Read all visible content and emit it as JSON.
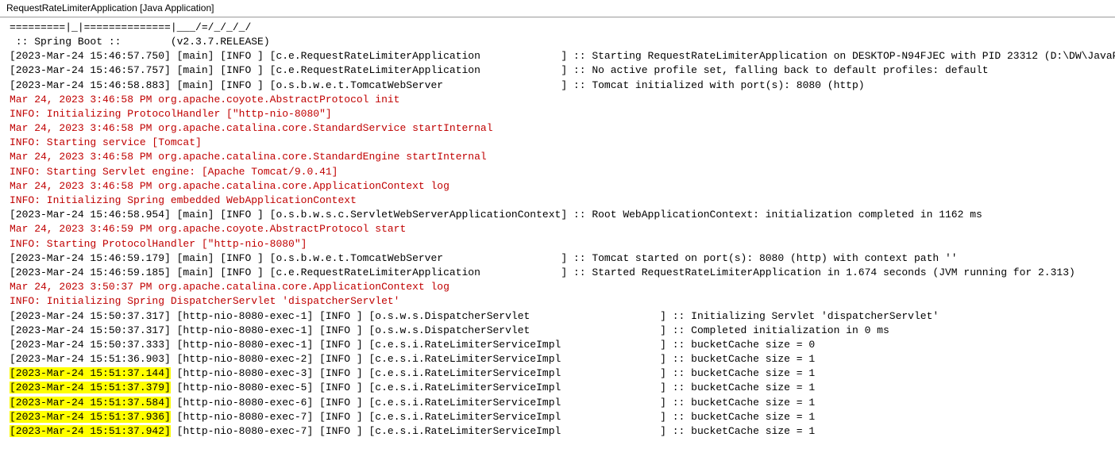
{
  "title": "RequestRateLimiterApplication [Java Application]",
  "lines": [
    {
      "text": "=========|_|==============|___/=/_/_/_/",
      "color": "black"
    },
    {
      "text": " :: Spring Boot ::        (v2.3.7.RELEASE)",
      "color": "black"
    },
    {
      "text": "",
      "color": "black"
    },
    {
      "text": "[2023-Mar-24 15:46:57.750] [main] [INFO ] [c.e.RequestRateLimiterApplication             ] :: Starting RequestRateLimiterApplication on DESKTOP-N94FJEC with PID 23312 (D:\\DW\\JavaP",
      "color": "black"
    },
    {
      "text": "[2023-Mar-24 15:46:57.757] [main] [INFO ] [c.e.RequestRateLimiterApplication             ] :: No active profile set, falling back to default profiles: default",
      "color": "black"
    },
    {
      "text": "[2023-Mar-24 15:46:58.883] [main] [INFO ] [o.s.b.w.e.t.TomcatWebServer                   ] :: Tomcat initialized with port(s): 8080 (http)",
      "color": "black"
    },
    {
      "text": "Mar 24, 2023 3:46:58 PM org.apache.coyote.AbstractProtocol init",
      "color": "red"
    },
    {
      "text": "INFO: Initializing ProtocolHandler [\"http-nio-8080\"]",
      "color": "red"
    },
    {
      "text": "Mar 24, 2023 3:46:58 PM org.apache.catalina.core.StandardService startInternal",
      "color": "red"
    },
    {
      "text": "INFO: Starting service [Tomcat]",
      "color": "red"
    },
    {
      "text": "Mar 24, 2023 3:46:58 PM org.apache.catalina.core.StandardEngine startInternal",
      "color": "red"
    },
    {
      "text": "INFO: Starting Servlet engine: [Apache Tomcat/9.0.41]",
      "color": "red"
    },
    {
      "text": "Mar 24, 2023 3:46:58 PM org.apache.catalina.core.ApplicationContext log",
      "color": "red"
    },
    {
      "text": "INFO: Initializing Spring embedded WebApplicationContext",
      "color": "red"
    },
    {
      "text": "[2023-Mar-24 15:46:58.954] [main] [INFO ] [o.s.b.w.s.c.ServletWebServerApplicationContext] :: Root WebApplicationContext: initialization completed in 1162 ms",
      "color": "black"
    },
    {
      "text": "Mar 24, 2023 3:46:59 PM org.apache.coyote.AbstractProtocol start",
      "color": "red"
    },
    {
      "text": "INFO: Starting ProtocolHandler [\"http-nio-8080\"]",
      "color": "red"
    },
    {
      "text": "[2023-Mar-24 15:46:59.179] [main] [INFO ] [o.s.b.w.e.t.TomcatWebServer                   ] :: Tomcat started on port(s): 8080 (http) with context path ''",
      "color": "black"
    },
    {
      "text": "[2023-Mar-24 15:46:59.185] [main] [INFO ] [c.e.RequestRateLimiterApplication             ] :: Started RequestRateLimiterApplication in 1.674 seconds (JVM running for 2.313)",
      "color": "black"
    },
    {
      "text": "Mar 24, 2023 3:50:37 PM org.apache.catalina.core.ApplicationContext log",
      "color": "red"
    },
    {
      "text": "INFO: Initializing Spring DispatcherServlet 'dispatcherServlet'",
      "color": "red"
    },
    {
      "text": "[2023-Mar-24 15:50:37.317] [http-nio-8080-exec-1] [INFO ] [o.s.w.s.DispatcherServlet                     ] :: Initializing Servlet 'dispatcherServlet'",
      "color": "black"
    },
    {
      "text": "[2023-Mar-24 15:50:37.317] [http-nio-8080-exec-1] [INFO ] [o.s.w.s.DispatcherServlet                     ] :: Completed initialization in 0 ms",
      "color": "black"
    },
    {
      "text": "[2023-Mar-24 15:50:37.333] [http-nio-8080-exec-1] [INFO ] [c.e.s.i.RateLimiterServiceImpl                ] :: bucketCache size = 0",
      "color": "black"
    },
    {
      "text": "[2023-Mar-24 15:51:36.903] [http-nio-8080-exec-2] [INFO ] [c.e.s.i.RateLimiterServiceImpl                ] :: bucketCache size = 1",
      "color": "black"
    },
    {
      "prefix": "[2023-Mar-24 15:51:37.144]",
      "rest": " [http-nio-8080-exec-3] [INFO ] [c.e.s.i.RateLimiterServiceImpl                ] :: bucketCache size = 1",
      "color": "black",
      "highlight": true
    },
    {
      "prefix": "[2023-Mar-24 15:51:37.379]",
      "rest": " [http-nio-8080-exec-5] [INFO ] [c.e.s.i.RateLimiterServiceImpl                ] :: bucketCache size = 1",
      "color": "black",
      "highlight": true
    },
    {
      "prefix": "[2023-Mar-24 15:51:37.584]",
      "rest": " [http-nio-8080-exec-6] [INFO ] [c.e.s.i.RateLimiterServiceImpl                ] :: bucketCache size = 1",
      "color": "black",
      "highlight": true
    },
    {
      "prefix": "[2023-Mar-24 15:51:37.936]",
      "rest": " [http-nio-8080-exec-7] [INFO ] [c.e.s.i.RateLimiterServiceImpl                ] :: bucketCache size = 1",
      "color": "black",
      "highlight": true
    },
    {
      "prefix": "[2023-Mar-24 15:51:37.942]",
      "rest": " [http-nio-8080-exec-7] [INFO ] [c.e.s.i.RateLimiterServiceImpl                ] :: bucketCache size = 1",
      "color": "black",
      "highlight": true
    }
  ]
}
